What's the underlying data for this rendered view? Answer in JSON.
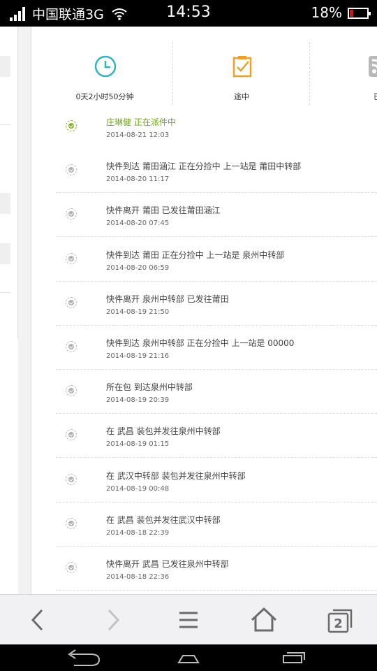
{
  "status_bar": {
    "carrier": "中国联通3G",
    "time": "14:53",
    "battery": "18%"
  },
  "summary": [
    {
      "label": "0天2小时50分钟",
      "icon": "clock-icon"
    },
    {
      "label": "途中",
      "icon": "checklist-icon"
    },
    {
      "label": "已i",
      "icon": "rss-icon"
    }
  ],
  "events": [
    {
      "text": "庄琳健 正在派件中",
      "time": "2014-08-21 12:03",
      "active": true
    },
    {
      "text": "快件到达 莆田涵江 正在分捡中 上一站是 莆田中转部",
      "time": "2014-08-20 11:17"
    },
    {
      "text": "快件离开 莆田 已发往莆田涵江",
      "time": "2014-08-20 07:45"
    },
    {
      "text": "快件到达 莆田 正在分捡中 上一站是 泉州中转部",
      "time": "2014-08-20 06:59"
    },
    {
      "text": "快件离开 泉州中转部 已发往莆田",
      "time": "2014-08-19 21:50"
    },
    {
      "text": "快件到达 泉州中转部 正在分捡中 上一站是 00000",
      "time": "2014-08-19 21:16"
    },
    {
      "text": "所在包 到达泉州中转部",
      "time": "2014-08-19 20:39"
    },
    {
      "text": "在 武昌 装包并发往泉州中转部",
      "time": "2014-08-19 01:15"
    },
    {
      "text": "在 武汉中转部 装包并发往泉州中转部",
      "time": "2014-08-19 00:48"
    },
    {
      "text": "在 武昌 装包并发往武汉中转部",
      "time": "2014-08-18 22:39"
    },
    {
      "text": "快件离开 武昌 已发往泉州中转部",
      "time": "2014-08-18 22:36"
    }
  ],
  "bottom_nav": [
    "back-arrow-icon",
    "forward-arrow-icon",
    "menu-icon",
    "home-icon",
    "windows-icon"
  ],
  "windows_count": "2",
  "system_nav": [
    "system-back-icon",
    "system-home-icon",
    "system-recents-icon"
  ],
  "colors": {
    "accent_green": "#6aa61b",
    "clock_teal": "#2ab3c2",
    "check_orange": "#f0a020",
    "battery_red": "#e01010"
  }
}
